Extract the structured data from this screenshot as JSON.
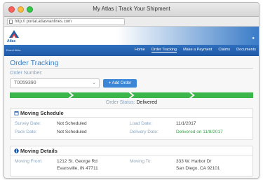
{
  "window": {
    "title": "My Atlas | Track Your Shipment"
  },
  "browser": {
    "url": "http:// portal.atlasvanlines.com"
  },
  "brand": {
    "logo_text": "Atlas",
    "tagline": "Brand Atlas",
    "accent": "#2f6fbd",
    "progress_color": "#3cb54a"
  },
  "nav": {
    "items": [
      {
        "label": "Home"
      },
      {
        "label": "Order Tracking"
      },
      {
        "label": "Make a Payment"
      },
      {
        "label": "Claims"
      },
      {
        "label": "Documents"
      }
    ]
  },
  "page": {
    "title": "Order Tracking"
  },
  "order": {
    "label": "Order Number:",
    "selected": "T0059390",
    "add_label": "+ Add Order"
  },
  "progress": {
    "segments_complete": 4,
    "segments_total": 4
  },
  "status": {
    "label": "Order Status:",
    "value": "Delivered"
  },
  "schedule": {
    "title": "Moving Schedule",
    "survey_label": "Survey Date:",
    "survey_value": "Not Scheduled",
    "pack_label": "Pack Date:",
    "pack_value": "Not Scheduled",
    "load_label": "Load Date:",
    "load_value": "11/1/2017",
    "delivery_label": "Delivery Date:",
    "delivery_value": "Delivered on 11/8/2017"
  },
  "details": {
    "title": "Moving Details",
    "from_label": "Moving From:",
    "from_line1": "1212 St. George Rd",
    "from_line2": "Evansville, IN 47711",
    "to_label": "Moving To:",
    "to_line1": "333 W. Harbor Dr",
    "to_line2": "San Diego, CA 92101"
  }
}
